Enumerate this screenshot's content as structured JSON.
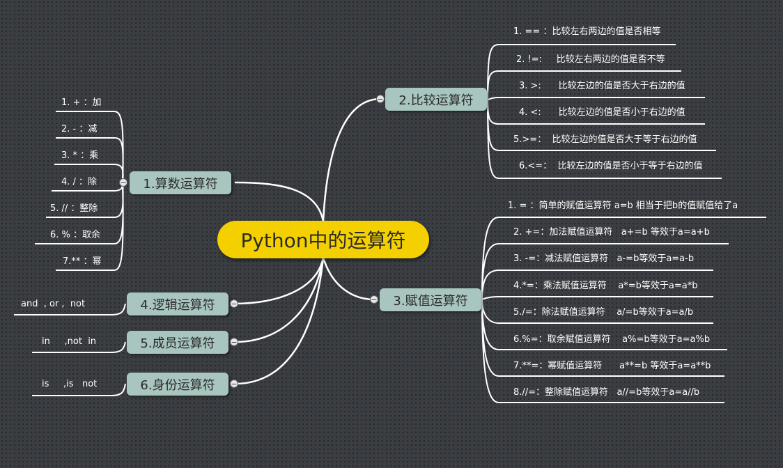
{
  "central": {
    "label": "Python中的运算符"
  },
  "branches": {
    "arith": {
      "label": "1.算数运算符"
    },
    "compare": {
      "label": "2.比较运算符"
    },
    "assign": {
      "label": "3.赋值运算符"
    },
    "logic": {
      "label": "4.逻辑运算符"
    },
    "member": {
      "label": "5.成员运算符"
    },
    "identity": {
      "label": "6.身份运算符"
    }
  },
  "collapse_symbol": "−",
  "leaves": {
    "arith": [
      "1. + ：加",
      "2. - ：减",
      "3. * ：乘",
      "4. / ：除",
      "5. // ：整除",
      "6. % ：取余",
      "7.** ：幂"
    ],
    "compare": [
      "1. == ：比较左右两边的值是否相等",
      "2. !=:     比较左右两边的值是否不等",
      "3. >:      比较左边的值是否大于右边的值",
      "4. <:      比较左边的值是否小于右边的值",
      "5.>=：  比较左边的值是否大于等于右边的值",
      "6.<=：  比较左边的值是否小于等于右边的值"
    ],
    "assign": [
      "1. = ：简单的赋值运算符 a=b 相当于把b的值赋值给了a",
      "2. +=：加法赋值运算符   a+=b 等效于a=a+b",
      "3. -=：减法赋值运算符   a-=b等效于a=a-b",
      "4.*=：乘法赋值运算符    a*=b等效于a=a*b",
      "5./=：除法赋值运算符    a/=b等效于a=a/b",
      "6.%=：取余赋值运算符    a%=b等效于a=a%b",
      "7.**=：幂赋值运算符      a**=b 等效于a=a**b",
      "8.//=：整除赋值运算符   a//=b等效于a=a//b"
    ],
    "logic": [
      "and  , or ,  not"
    ],
    "member": [
      "in     ,not  in"
    ],
    "identity": [
      "is     ,is   not"
    ]
  }
}
